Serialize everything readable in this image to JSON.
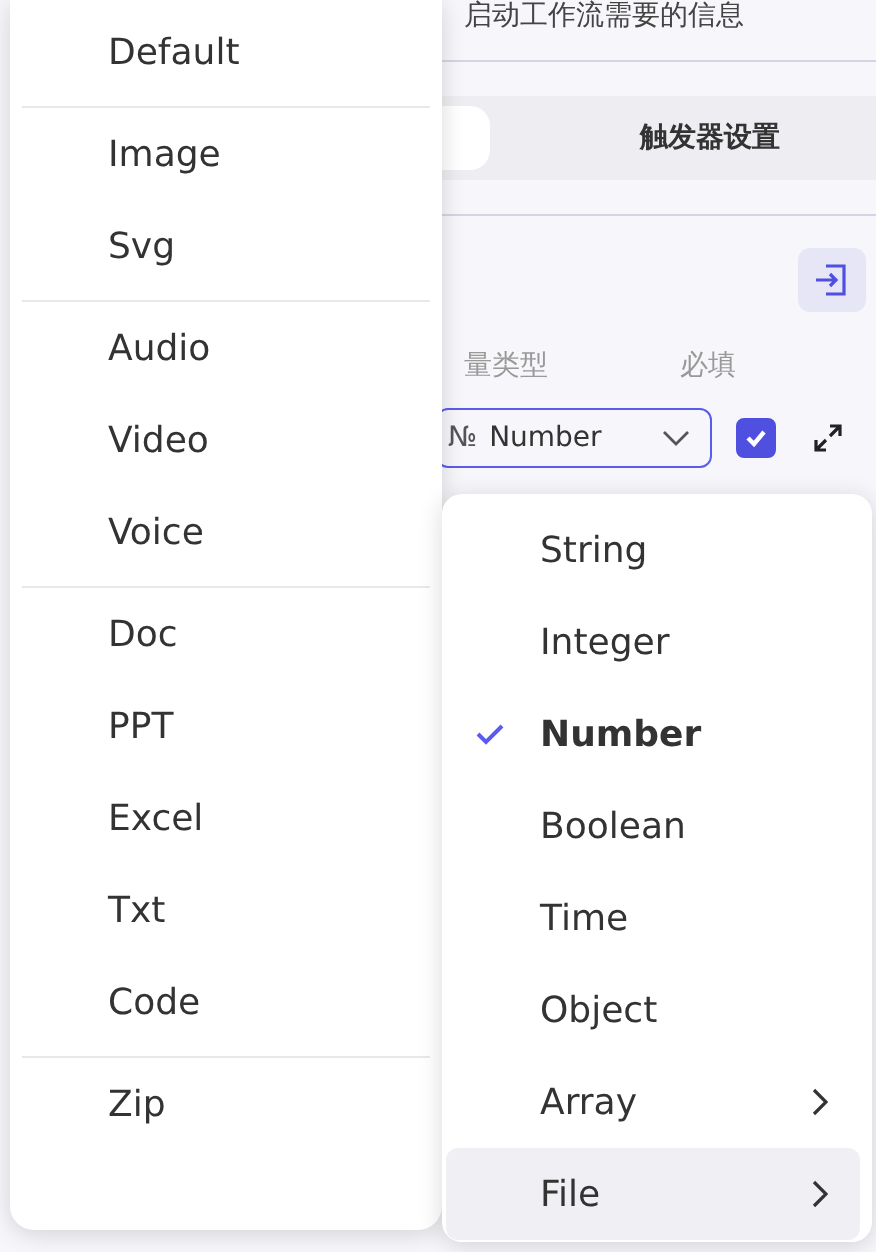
{
  "page": {
    "subtitle": "启动工作流需要的信息",
    "tab": "触发器设置",
    "columns": [
      "量类型",
      "必填"
    ],
    "row": {
      "type_symbol": "№",
      "type": "Number",
      "required": true
    }
  },
  "type_menu": {
    "items": [
      {
        "label": "String",
        "selected": false,
        "submenu": false,
        "highlighted": false
      },
      {
        "label": "Integer",
        "selected": false,
        "submenu": false,
        "highlighted": false
      },
      {
        "label": "Number",
        "selected": true,
        "submenu": false,
        "highlighted": false
      },
      {
        "label": "Boolean",
        "selected": false,
        "submenu": false,
        "highlighted": false
      },
      {
        "label": "Time",
        "selected": false,
        "submenu": false,
        "highlighted": false
      },
      {
        "label": "Object",
        "selected": false,
        "submenu": false,
        "highlighted": false
      },
      {
        "label": "Array",
        "selected": false,
        "submenu": true,
        "highlighted": false
      },
      {
        "label": "File",
        "selected": false,
        "submenu": true,
        "highlighted": true
      }
    ]
  },
  "file_menu": {
    "groups": [
      {
        "items": [
          "Default"
        ]
      },
      {
        "items": [
          "Image",
          "Svg"
        ]
      },
      {
        "items": [
          "Audio",
          "Video",
          "Voice"
        ]
      },
      {
        "items": [
          "Doc",
          "PPT",
          "Excel",
          "Txt",
          "Code"
        ]
      },
      {
        "items": [
          "Zip"
        ]
      }
    ]
  }
}
